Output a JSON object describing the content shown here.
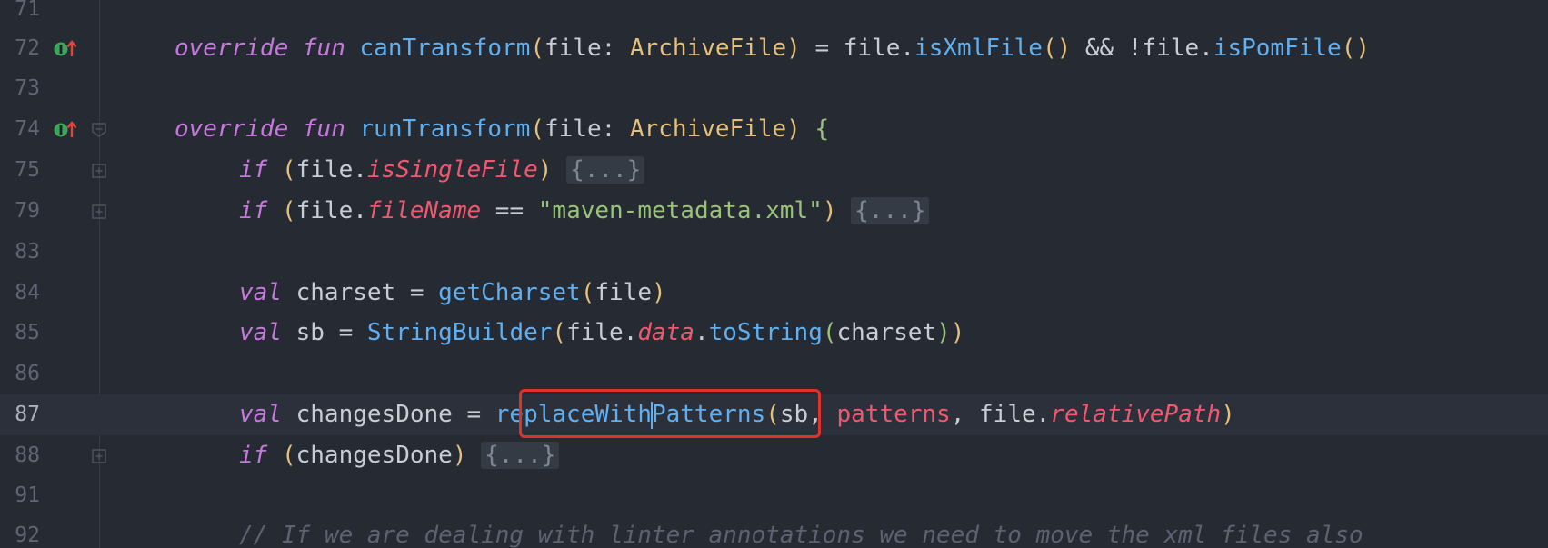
{
  "editor": {
    "language": "kotlin",
    "current_line": "87",
    "lines": [
      {
        "num": "71"
      },
      {
        "num": "72",
        "icon": "override-icon"
      },
      {
        "num": "73"
      },
      {
        "num": "74",
        "icon": "override-icon"
      },
      {
        "num": "75"
      },
      {
        "num": "79"
      },
      {
        "num": "83"
      },
      {
        "num": "84"
      },
      {
        "num": "85"
      },
      {
        "num": "86"
      },
      {
        "num": "87"
      },
      {
        "num": "88"
      },
      {
        "num": "91"
      },
      {
        "num": "92"
      }
    ],
    "tokens": {
      "override": "override",
      "fun": "fun",
      "canTransform": "canTransform",
      "runTransform": "runTransform",
      "file": "file",
      "colon_space": ": ",
      "ArchiveFile": "ArchiveFile",
      "eq": " = ",
      "isXmlFile": "isXmlFile",
      "and_not": " && !",
      "isPomFile": "isPomFile",
      "if": "if",
      "isSingleFile": "isSingleFile",
      "fileName": "fileName",
      "eqeq": " == ",
      "maven_str": "\"maven-metadata.xml\"",
      "folded": "{...}",
      "val": "val",
      "charset": "charset",
      "getCharset": "getCharset",
      "sb": "sb",
      "StringBuilder": "StringBuilder",
      "data": "data",
      "toString": "toString",
      "changesDone": "changesDone",
      "replaceWith": "replaceWith",
      "Patterns": "Patterns",
      "patterns": "patterns",
      "relativePath": "relativePath",
      "comment": "// If we are dealing with linter annotations we need to move the xml files also"
    }
  },
  "colors": {
    "background": "#262a33",
    "keyword": "#c678dd",
    "function": "#61afef",
    "type": "#e5c07b",
    "property": "#ef596f",
    "string": "#98c379",
    "comment": "#5c6370",
    "highlight_box": "#e0312a"
  }
}
